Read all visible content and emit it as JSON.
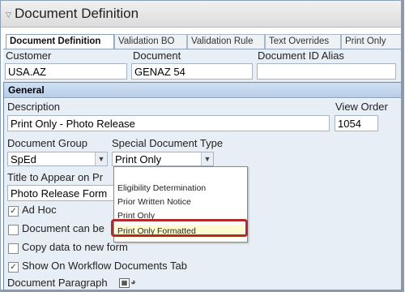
{
  "window": {
    "title": "Document Definition",
    "title_icon": "collapse-triangle-icon"
  },
  "tabs": [
    {
      "label": "Document Definition",
      "active": true
    },
    {
      "label": "Validation BO",
      "active": false
    },
    {
      "label": "Validation Rule",
      "active": false
    },
    {
      "label": "Text Overrides",
      "active": false
    },
    {
      "label": "Print Only",
      "active": false
    }
  ],
  "top_fields": {
    "customer": {
      "label": "Customer",
      "value": "USA.AZ"
    },
    "document": {
      "label": "Document",
      "value": "GENAZ 54"
    },
    "document_id_alias": {
      "label": "Document ID Alias",
      "value": ""
    }
  },
  "general": {
    "header": "General",
    "description": {
      "label": "Description",
      "value": "Print Only - Photo Release"
    },
    "view_order": {
      "label": "View Order",
      "value": "1054"
    },
    "document_group": {
      "label": "Document Group",
      "value": "SpEd"
    },
    "special_document_type": {
      "label": "Special Document Type",
      "value": "Print Only"
    },
    "title_to_appear": {
      "label": "Title to Appear on Pr",
      "value": "Photo Release Form"
    },
    "checkboxes": {
      "ad_hoc": {
        "label": "Ad Hoc",
        "checked": true
      },
      "document_can_be": {
        "label": "Document can be",
        "checked": false
      },
      "copy_data": {
        "label": "Copy data to new form",
        "checked": false
      },
      "show_on_workflow": {
        "label": "Show On Workflow Documents Tab",
        "checked": true
      }
    },
    "document_paragraph": {
      "label": "Document Paragraph"
    }
  },
  "dropdown": {
    "options": [
      "",
      "Eligibility Determination",
      "Prior Written Notice",
      "Print Only",
      "Print Only Formatted"
    ],
    "highlighted": "Print Only Formatted"
  },
  "colors": {
    "panel_header": "#c3d6ec",
    "highlight_ring": "#b22a2a",
    "highlight_fill": "#fffbd0"
  }
}
